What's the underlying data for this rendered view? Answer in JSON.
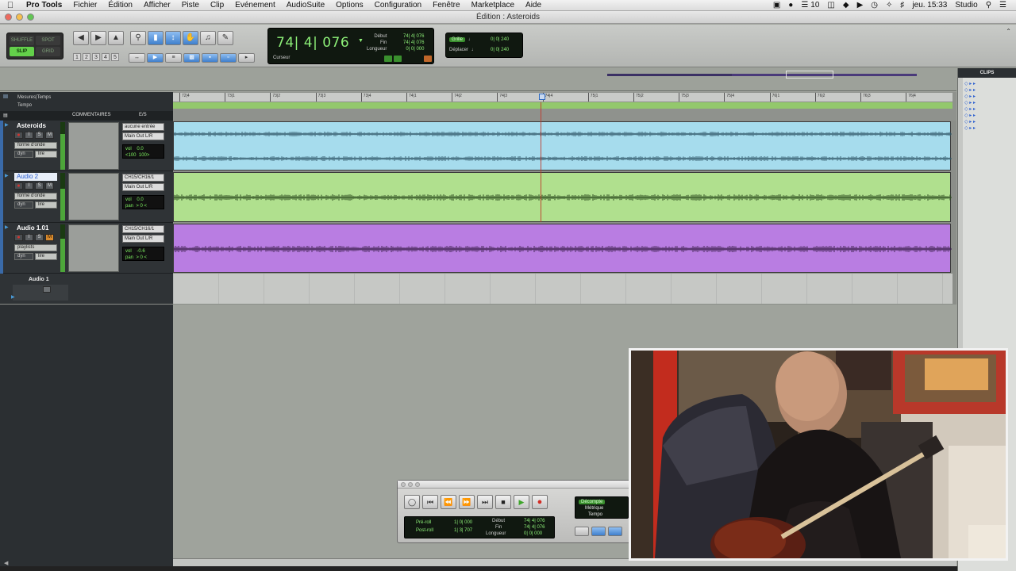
{
  "menubar": {
    "app_name": "Pro Tools",
    "items": [
      "Fichier",
      "Édition",
      "Afficher",
      "Piste",
      "Clip",
      "Evénement",
      "AudioSuite",
      "Options",
      "Configuration",
      "Fenêtre",
      "Marketplace",
      "Aide"
    ],
    "status": {
      "badge": "10",
      "clock": "jeu. 15:33",
      "user": "Studio"
    }
  },
  "window": {
    "title": "Édition : Asteroids"
  },
  "toolbar": {
    "modes": [
      "SHUFFLE",
      "SPOT",
      "SLIP",
      "GRID"
    ],
    "zoom_presets": [
      "1",
      "2",
      "3",
      "4",
      "5"
    ],
    "main_counter": "74| 4| 076",
    "counter_sublabel": "Curseur",
    "selection_labels": [
      "Début",
      "Fin",
      "Longueur"
    ],
    "selection_values": [
      "74| 4| 076",
      "74| 4| 076",
      "0| 0| 000"
    ],
    "grid_label": "Grille",
    "grid_value": "0| 0| 240",
    "nudge_label": "Déplacer",
    "nudge_value": "0| 0| 240"
  },
  "rulers": {
    "labels": [
      "Mesures|Temps",
      "Tempo"
    ],
    "ticks": [
      "72|4",
      "73|1",
      "73|2",
      "73|3",
      "73|4",
      "74|1",
      "74|2",
      "74|3",
      "74|4",
      "75|1",
      "75|2",
      "75|3",
      "75|4",
      "76|1",
      "76|2",
      "76|3",
      "76|4"
    ],
    "headers": {
      "comments": "COMMENTAIRES",
      "io": "E/S"
    }
  },
  "tracks": [
    {
      "name": "Asteroids",
      "view": "forme d'onde",
      "automation": "dyn",
      "auto_mode": "lire",
      "input": "aucune entrée",
      "output": "Main Out L/R",
      "vol": "0.0",
      "pan_l": "<100",
      "pan_r": "100>",
      "color": "#a6dced"
    },
    {
      "name": "Audio 2",
      "view": "forme d'onde",
      "automation": "dyn",
      "auto_mode": "lire",
      "input": "CH15/CH16/1",
      "output": "Main Out L/R",
      "vol": "0.0",
      "pan_l": "pan",
      "pan_r": "> 0 <",
      "color": "#b0e08e"
    },
    {
      "name": "Audio 1.01",
      "view": "playlists",
      "automation": "dyn",
      "auto_mode": "lire",
      "input": "CH15/CH16/1",
      "output": "Main Out L/R",
      "vol": "-0.6",
      "pan_l": "pan",
      "pan_r": "> 0 <",
      "color": "#b97de2"
    },
    {
      "name": "Audio 1"
    }
  ],
  "clips_panel": {
    "title": "CLIPS"
  },
  "transport": {
    "preroll": "Pré-roll",
    "postroll": "Post-roll",
    "preroll_val": "1| 0| 000",
    "postroll_val": "1| 3| 707",
    "labels": [
      "Début",
      "Fin",
      "Longueur"
    ],
    "values": [
      "74| 4| 076",
      "74| 4| 076",
      "0| 0| 000"
    ],
    "count_off": "Décompte",
    "metronome": "Métrique",
    "tempo": "Tempo"
  },
  "colors": {
    "accent_green": "#63d04a",
    "counter_green": "#8df078",
    "playhead": "#c0392b"
  }
}
